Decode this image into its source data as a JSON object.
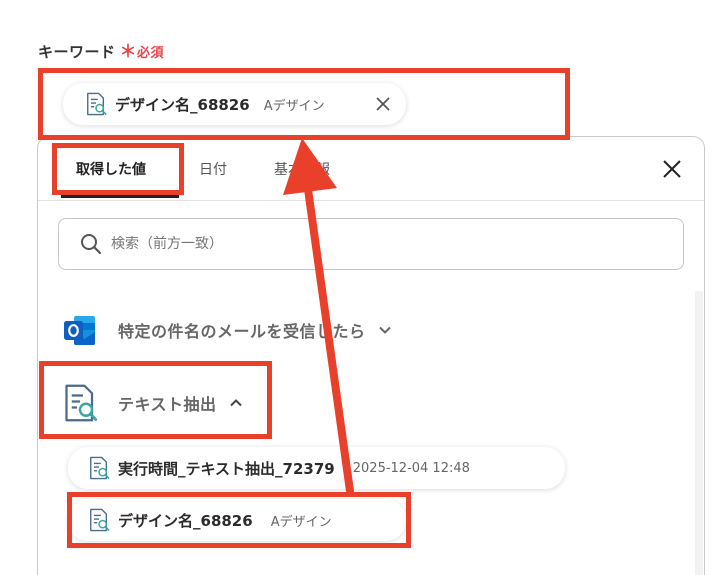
{
  "field": {
    "label": "キーワード",
    "required_mark": "＊",
    "required_text": "必須"
  },
  "selected_tag": {
    "name": "デザイン名_68826",
    "meta": "Aデザイン",
    "icon": "document-search-icon"
  },
  "panel": {
    "tabs": [
      {
        "label": "取得した値",
        "active": true
      },
      {
        "label": "日付",
        "active": false
      },
      {
        "label": "基本情報",
        "active": false
      }
    ],
    "search_placeholder": "検索（前方一致）",
    "sections": [
      {
        "label": "特定の件名のメールを受信したら",
        "icon": "outlook-icon",
        "state": "collapsed"
      },
      {
        "label": "テキスト抽出",
        "icon": "document-search-icon",
        "state": "expanded"
      }
    ],
    "items": [
      {
        "name": "実行時間_テキスト抽出_72379",
        "meta": "2025-12-04 12:48"
      },
      {
        "name": "デザイン名_68826",
        "meta": "Aデザイン"
      }
    ]
  },
  "colors": {
    "highlight": "#e8402a",
    "required": "#e5484d",
    "outlook_blue": "#0a64c8"
  }
}
